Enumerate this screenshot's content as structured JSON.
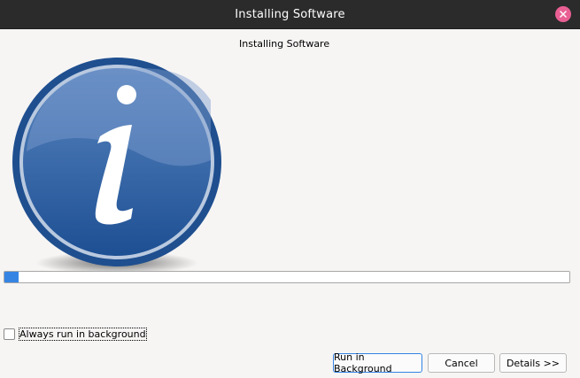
{
  "window": {
    "title": "Installing Software",
    "close_icon": "close-icon"
  },
  "main": {
    "header": "Installing Software",
    "icon": "info-icon",
    "progress_percent": 2.5,
    "always_run_background_label": "Always run in background",
    "always_run_background_checked": false
  },
  "buttons": {
    "run_background": "Run in Background",
    "cancel": "Cancel",
    "details": "Details >>"
  },
  "colors": {
    "titlebar": "#2b2b2b",
    "close_button": "#e95f94",
    "progress_fill": "#3584e4",
    "icon_blue": "#2a5a9c"
  }
}
